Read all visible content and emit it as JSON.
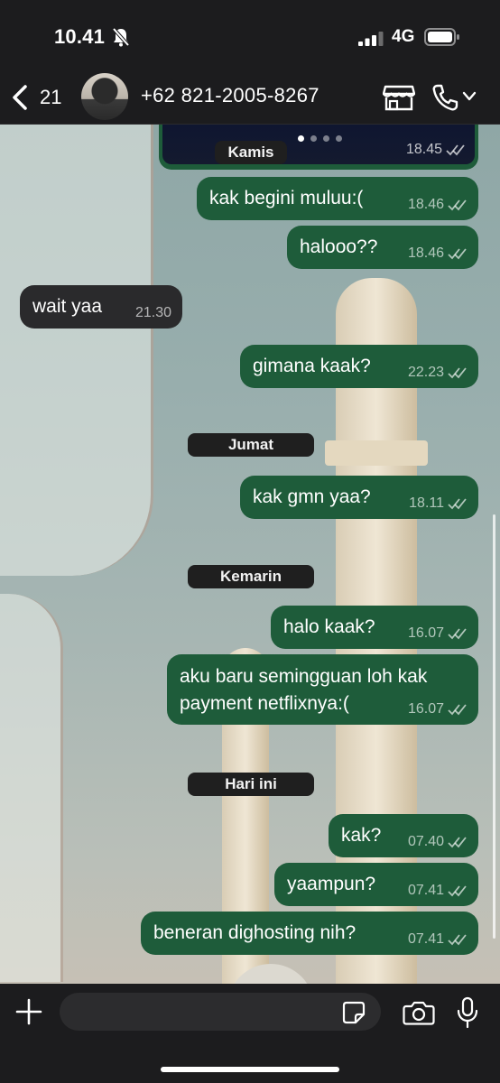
{
  "status_bar": {
    "time": "10.41",
    "network": "4G"
  },
  "header": {
    "back_count": "21",
    "contact_name": "+62 821-2005-8267"
  },
  "media_message": {
    "overlay_date": "Kamis",
    "time": "18.45"
  },
  "messages": [
    {
      "id": "m1",
      "direction": "out",
      "text": "kak begini muluu:(",
      "time": "18.46"
    },
    {
      "id": "m2",
      "direction": "out",
      "text": "halooo??",
      "time": "18.46"
    },
    {
      "id": "m3",
      "direction": "in",
      "text": "wait yaa",
      "time": "21.30"
    },
    {
      "id": "m4",
      "direction": "out",
      "text": "gimana kaak?",
      "time": "22.23"
    },
    {
      "id": "d1",
      "type": "date",
      "text": "Jumat"
    },
    {
      "id": "m5",
      "direction": "out",
      "text": "kak gmn yaa?",
      "time": "18.11"
    },
    {
      "id": "d2",
      "type": "date",
      "text": "Kemarin"
    },
    {
      "id": "m6",
      "direction": "out",
      "text": "halo kaak?",
      "time": "16.07"
    },
    {
      "id": "m7",
      "direction": "out",
      "text": "aku baru semingguan loh kak\npayment netflixnya:(",
      "time": "16.07"
    },
    {
      "id": "d3",
      "type": "date",
      "text": "Hari ini"
    },
    {
      "id": "m8",
      "direction": "out",
      "text": "kak?",
      "time": "07.40"
    },
    {
      "id": "m9",
      "direction": "out",
      "text": "yaampun?",
      "time": "07.41"
    },
    {
      "id": "m10",
      "direction": "out",
      "text": "beneran dighosting nih?",
      "time": "07.41"
    }
  ],
  "input": {
    "placeholder": ""
  },
  "icons": {
    "back": "chevron-left-icon",
    "muted": "bell-off-icon",
    "signal": "signal-icon",
    "battery": "battery-icon",
    "store": "store-icon",
    "call": "phone-icon",
    "attach": "plus-icon",
    "sticker": "sticker-icon",
    "camera": "camera-icon",
    "mic": "mic-icon",
    "read": "double-check-icon"
  },
  "colors": {
    "outgoing_bubble": "#1e5c3a",
    "incoming_bubble": "#2a2a2c",
    "bar_background": "#1c1c1e",
    "date_chip": "#1f1f1f"
  }
}
